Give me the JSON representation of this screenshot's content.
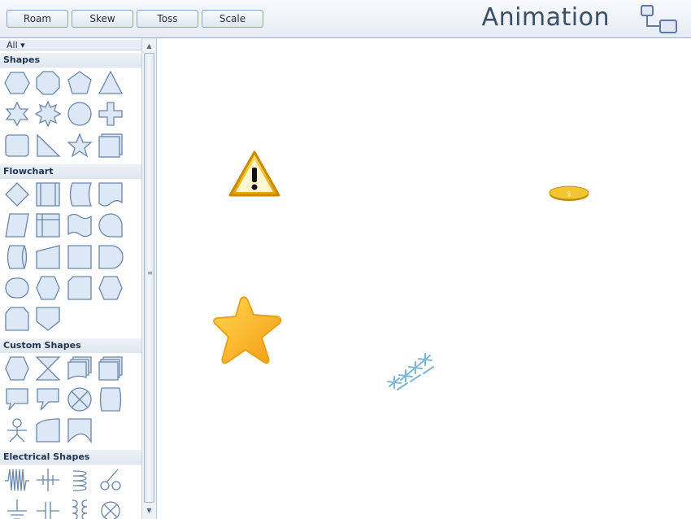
{
  "toolbar": {
    "buttons": [
      "Roam",
      "Skew",
      "Toss",
      "Scale"
    ],
    "title": "Animation",
    "logo_icon": "diagram-connector-icon"
  },
  "sidebar": {
    "filter": "All ▾",
    "categories": [
      {
        "label": "Shapes",
        "items": [
          "hexagon",
          "octagon",
          "pentagon",
          "triangle",
          "six-point-star",
          "eight-point-star",
          "circle",
          "cross",
          "rounded-rectangle",
          "right-triangle",
          "five-point-star",
          "stacked-square"
        ]
      },
      {
        "label": "Flowchart",
        "items": [
          "decision",
          "predefined-process",
          "stored-data",
          "document",
          "data",
          "internal-storage",
          "punched-tape",
          "sequential-data",
          "direct-data",
          "manual-input",
          "card",
          "delay",
          "terminator",
          "preparation",
          "off-page-connector",
          "display",
          "loop-limit",
          "off-page-reference"
        ]
      },
      {
        "label": "Custom Shapes",
        "items": [
          "hexagon-custom",
          "collate",
          "multi-document",
          "stacked-pages",
          "speech-bubble",
          "callout",
          "summing-junction",
          "tab-shape",
          "stick-figure",
          "curved-panel",
          "wave-card"
        ]
      },
      {
        "label": "Electrical Shapes",
        "items": [
          "fuse",
          "crossing-wire",
          "inductor",
          "switch",
          "ground",
          "capacitor",
          "transformer",
          "lamp"
        ]
      }
    ]
  },
  "canvas": {
    "objects": [
      "warning-sign-icon",
      "coin-icon",
      "star-icon",
      "snowflakes-icon"
    ]
  },
  "colors": {
    "accent": "#8ea3bf",
    "shape_fill": "#dce8f6",
    "shape_stroke": "#6b86a8",
    "star": "#f7b21f",
    "warning": "#f4c21a"
  }
}
